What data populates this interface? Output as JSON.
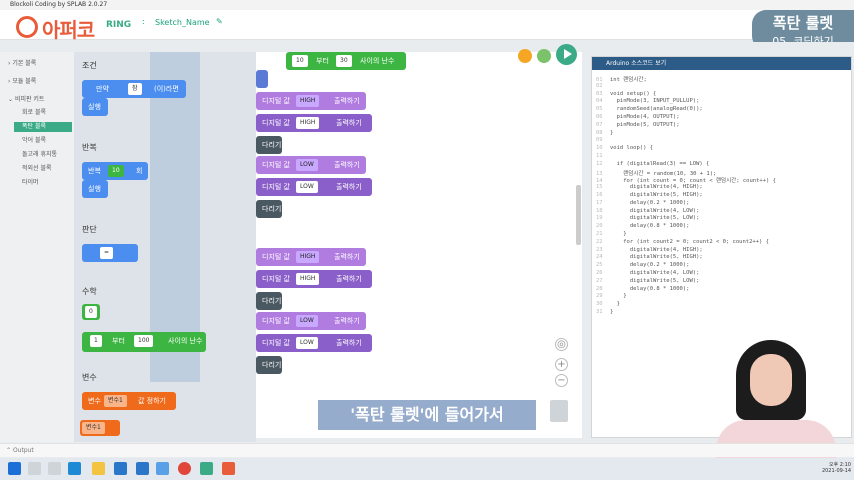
{
  "window": {
    "title": "Blockoli Coding by SPLAB 2.0.27"
  },
  "header": {
    "logo_text": "아퍼코",
    "logo_suffix": "RING",
    "sketch_name": "Sketch_Name"
  },
  "badge": {
    "title": "폭탄 룰렛",
    "subtitle": "05. 코딩하기"
  },
  "sidebar": {
    "categories": [
      "기본 블록",
      "모듈 블록",
      "비피판 키트"
    ],
    "subitems": [
      "회로 블록",
      "폭탄 블록",
      "악어 블록",
      "돌고래 휴지통",
      "적외선 블록",
      "타이머"
    ],
    "active_index": 1
  },
  "palette": {
    "sections": {
      "condition": "조건",
      "loop": "반복",
      "judge": "판단",
      "math": "수학",
      "variable": "변수"
    },
    "if_block": {
      "prefix": "만약",
      "value": "참",
      "suffix": "(이)라면",
      "body": "실행"
    },
    "repeat_block": {
      "prefix": "반복",
      "count": "10",
      "suffix": "회",
      "body": "실행"
    },
    "compare_block": {
      "op": "="
    },
    "number_block": {
      "value": "0"
    },
    "random_block": {
      "from": "1",
      "mid": "부터",
      "to": "100",
      "suffix": "사이의 난수"
    },
    "var_set_block": {
      "prefix": "변수",
      "name": "변수1",
      "suffix": "값 정하기"
    },
    "var_get_block": {
      "name": "변수1"
    }
  },
  "workspace": {
    "top_random": {
      "from": "10",
      "mid": "부터",
      "to": "30",
      "suffix": "사이의 난수"
    },
    "digital_label": "디지털 값",
    "output_label": "출력하기",
    "wait_label": "다리기",
    "rows": [
      {
        "value": "HIGH",
        "hl": true
      },
      {
        "value": "HIGH",
        "hl": false
      },
      {
        "value": "LOW",
        "hl": true
      },
      {
        "value": "LOW",
        "hl": false
      },
      {
        "value": "HIGH",
        "hl": true
      },
      {
        "value": "HIGH",
        "hl": false
      },
      {
        "value": "LOW",
        "hl": true
      },
      {
        "value": "LOW",
        "hl": false
      }
    ]
  },
  "code": {
    "header": "Arduino 소스코드 보기",
    "lines": [
      "int 랜덤시간;",
      "",
      "void setup() {",
      "  pinMode(3, INPUT_PULLUP);",
      "  randomSeed(analogRead(0));",
      "  pinMode(4, OUTPUT);",
      "  pinMode(5, OUTPUT);",
      "}",
      "",
      "void loop() {",
      "",
      "  if (digitalRead(3) == LOW) {",
      "    랜덤시간 = random(10, 30 + 1);",
      "    for (int count = 0; count < 랜덤시간; count++) {",
      "      digitalWrite(4, HIGH);",
      "      digitalWrite(5, HIGH);",
      "      delay(0.2 * 1000);",
      "      digitalWrite(4, LOW);",
      "      digitalWrite(5, LOW);",
      "      delay(0.8 * 1000);",
      "    }",
      "    for (int count2 = 0; count2 < 0; count2++) {",
      "      digitalWrite(4, HIGH);",
      "      digitalWrite(5, HIGH);",
      "      delay(0.2 * 1000);",
      "      digitalWrite(4, LOW);",
      "      digitalWrite(5, LOW);",
      "      delay(0.8 * 1000);",
      "    }",
      "  }",
      "}"
    ]
  },
  "subtitle": "'폭탄 룰렛'에 들어가서",
  "output_label": "Output",
  "clock": {
    "time": "오후 2:10",
    "date": "2021-09-14"
  },
  "colors": {
    "accent": "#3aab86",
    "code_header": "#2c5b87",
    "badge": "#6e8c9e"
  }
}
